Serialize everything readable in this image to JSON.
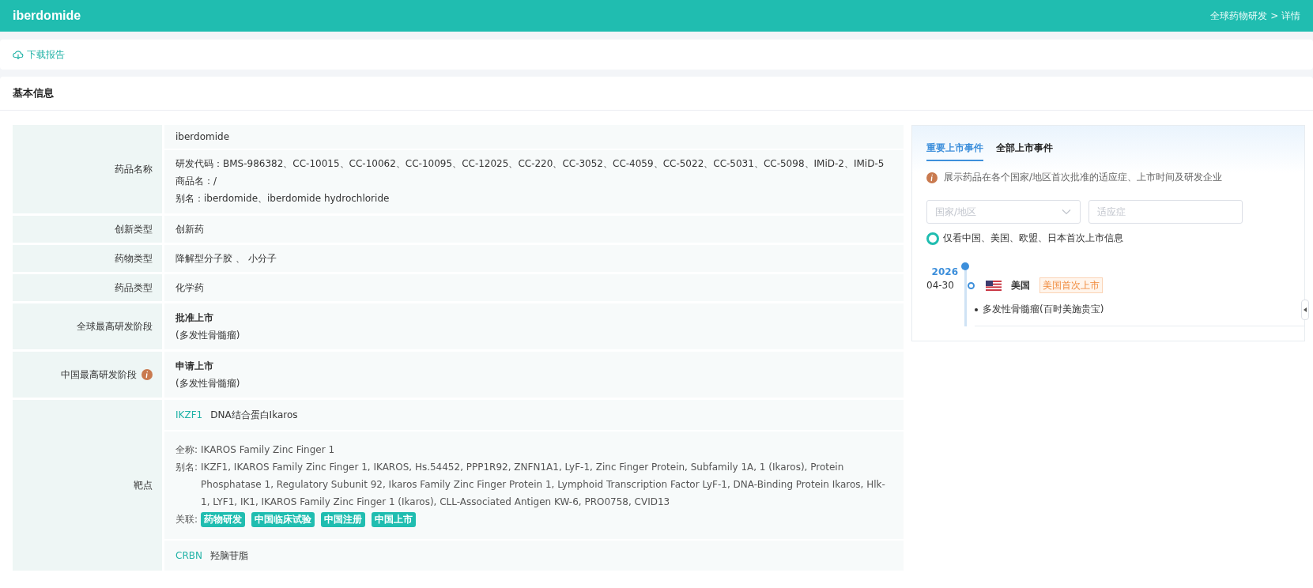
{
  "header": {
    "title": "iberdomide",
    "breadcrumb": "全球药物研发 > 详情"
  },
  "toolbar": {
    "download": "下载报告"
  },
  "section": {
    "title": "基本信息"
  },
  "info_rows": [
    {
      "kind": "name",
      "label": "药品名称",
      "primary": "iberdomide",
      "lines": [
        "研发代码：BMS-986382、CC-10015、CC-10062、CC-10095、CC-12025、CC-220、CC-3052、CC-4059、CC-5022、CC-5031、CC-5098、IMiD-2、IMiD-5",
        "商品名：/",
        "别名：iberdomide、iberdomide hydrochloride"
      ]
    },
    {
      "kind": "plain",
      "label": "创新类型",
      "value": "创新药"
    },
    {
      "kind": "plain",
      "label": "药物类型",
      "value": "降解型分子胶 、 小分子"
    },
    {
      "kind": "plain",
      "label": "药品类型",
      "value": "化学药"
    },
    {
      "kind": "stage",
      "label": "全球最高研发阶段",
      "info": false,
      "stage": "批准上市",
      "note": "(多发性骨髓瘤)"
    },
    {
      "kind": "stage",
      "label": "中国最高研发阶段",
      "info": true,
      "stage": "申请上市",
      "note": "(多发性骨髓瘤)"
    },
    {
      "kind": "targets",
      "label": "靶点",
      "targets": [
        {
          "code": "IKZF1",
          "name": "DNA结合蛋白Ikaros",
          "full_label": "全称:",
          "full": "IKAROS Family Zinc Finger 1",
          "alias_label": "别名:",
          "alias": "IKZF1, IKAROS Family Zinc Finger 1, IKAROS, Hs.54452, PPP1R92, ZNFN1A1, LyF-1, Zinc Finger Protein, Subfamily 1A, 1 (Ikaros), Protein Phosphatase 1, Regulatory Subunit 92, Ikaros Family Zinc Finger Protein 1, Lymphoid Transcription Factor LyF-1, DNA-Binding Protein Ikaros, Hlk-1, LYF1, IK1, IKAROS Family Zinc Finger 1 (Ikaros), CLL-Associated Antigen KW-6, PRO0758, CVID13",
          "links_label": "关联:",
          "links": [
            "药物研发",
            "中国临床试验",
            "中国注册",
            "中国上市"
          ]
        },
        {
          "code": "CRBN",
          "name": "羟脑苷脂"
        }
      ]
    }
  ],
  "events": {
    "tabs": [
      {
        "label": "重要上市事件",
        "selected": true
      },
      {
        "label": "全部上市事件",
        "selected": false
      }
    ],
    "note": "展示药品在各个国家/地区首次批准的适应症、上市时间及研发企业",
    "country_placeholder": "国家/地区",
    "indication_placeholder": "适应症",
    "filter": {
      "label": "仅看中国、美国、欧盟、日本首次上市信息",
      "checked": true
    },
    "timeline": [
      {
        "year": "2026",
        "entries": [
          {
            "date": "04-30",
            "country": "美国",
            "tag": "美国首次上市",
            "items": [
              "多发性骨髓瘤(百时美施贵宝)"
            ]
          }
        ]
      }
    ]
  }
}
